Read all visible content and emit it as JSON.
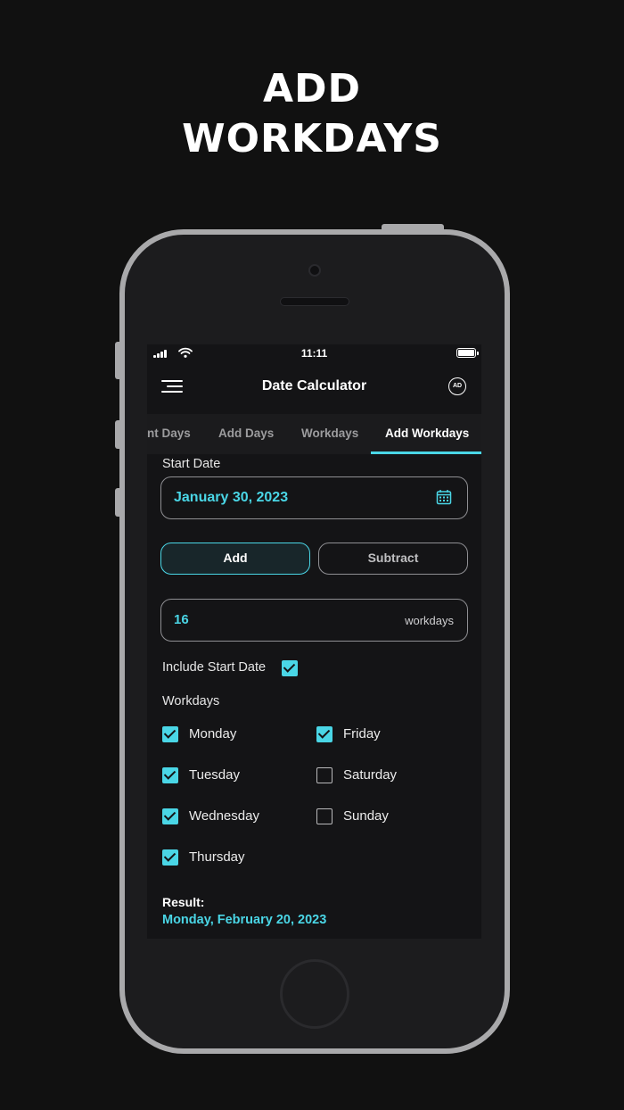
{
  "headline": {
    "line1": "ADD",
    "line2": "WORKDAYS"
  },
  "status": {
    "time": "11:11"
  },
  "nav": {
    "title": "Date Calculator",
    "ad_badge": "AD"
  },
  "tabs": [
    {
      "label": "nt Days"
    },
    {
      "label": "Add Days"
    },
    {
      "label": "Workdays"
    },
    {
      "label": "Add Workdays",
      "active": true
    }
  ],
  "form": {
    "start_date_label": "Start Date",
    "start_date_value": "January 30, 2023",
    "add_label": "Add",
    "subtract_label": "Subtract",
    "selected_operation": "Add",
    "quantity": "16",
    "quantity_unit": "workdays",
    "include_start_label": "Include Start Date",
    "include_start_checked": true,
    "workdays_label": "Workdays",
    "days": [
      {
        "label": "Monday",
        "checked": true
      },
      {
        "label": "Tuesday",
        "checked": true
      },
      {
        "label": "Wednesday",
        "checked": true
      },
      {
        "label": "Thursday",
        "checked": true
      },
      {
        "label": "Friday",
        "checked": true
      },
      {
        "label": "Saturday",
        "checked": false
      },
      {
        "label": "Sunday",
        "checked": false
      }
    ]
  },
  "result": {
    "title": "Result:",
    "value": "Monday, February 20, 2023"
  },
  "colors": {
    "accent": "#4ad6e6",
    "background": "#111111",
    "screen": "#141416"
  }
}
